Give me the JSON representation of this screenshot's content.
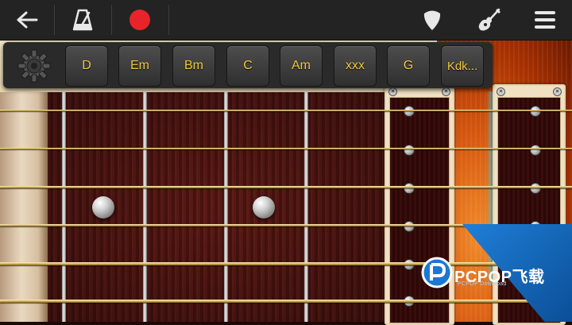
{
  "toolbar": {
    "back_icon": "arrow-left-icon",
    "metronome_icon": "metronome-icon",
    "record_icon": "record-icon",
    "pick_icon": "guitar-pick-icon",
    "guitar_icon": "guitar-icon",
    "menu_icon": "menu-icon",
    "record_color": "#e8232a"
  },
  "chord_bar": {
    "settings_icon": "gear-icon",
    "chords": [
      "D",
      "Em",
      "Bm",
      "C",
      "Am",
      "xxx",
      "G",
      "Kdk..."
    ],
    "chord_text_color": "#f0c93a"
  },
  "fretboard": {
    "string_count": 6,
    "fret_count": 4,
    "marker_dots": 2,
    "bridge_close_icon": "close-icon"
  },
  "watermark": {
    "brand": "PCPOP飞载",
    "sub": "PCPOP Download"
  }
}
